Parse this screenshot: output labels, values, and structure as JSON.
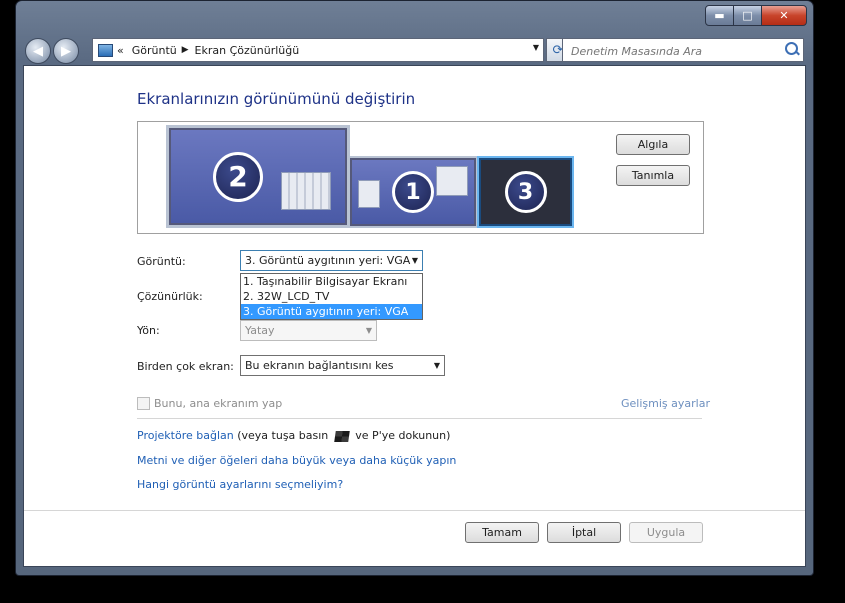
{
  "window": {
    "controls": {
      "minimize": "▬",
      "maximize": "□",
      "close": "✕"
    }
  },
  "navbar": {
    "back": "◀",
    "forward": "▶",
    "breadcrumb_chevron": "«",
    "breadcrumb": [
      "Görüntü",
      "Ekran Çözünürlüğü"
    ],
    "search_placeholder": "Denetim Masasında Ara"
  },
  "page": {
    "title": "Ekranlarınızın görünümünü değiştirin",
    "monitors": [
      "2",
      "1",
      "3"
    ],
    "detect_button": "Algıla",
    "identify_button": "Tanımla"
  },
  "form": {
    "display_label": "Görüntü:",
    "display_value": "3. Görüntü aygıtının yeri: VGA",
    "display_options": [
      "1. Taşınabilir Bilgisayar Ekranı",
      "2. 32W_LCD_TV",
      "3. Görüntü aygıtının yeri: VGA"
    ],
    "resolution_label": "Çözünürlük:",
    "orientation_label": "Yön:",
    "orientation_value": "Yatay",
    "multi_label": "Birden çok ekran:",
    "multi_value": "Bu ekranın bağlantısını kes",
    "main_display_check": "Bunu, ana ekranım yap",
    "advanced_link": "Gelişmiş ayarlar"
  },
  "links": {
    "projector_link": "Projektöre bağlan",
    "projector_rest_1": "(veya tuşa basın",
    "projector_rest_2": "ve P'ye dokunun)",
    "text_size_link": "Metni ve diğer öğeleri daha büyük veya daha küçük yapın",
    "which_settings_link": "Hangi görüntü ayarlarını seçmeliyim?"
  },
  "footer": {
    "ok": "Tamam",
    "cancel": "İptal",
    "apply": "Uygula"
  }
}
